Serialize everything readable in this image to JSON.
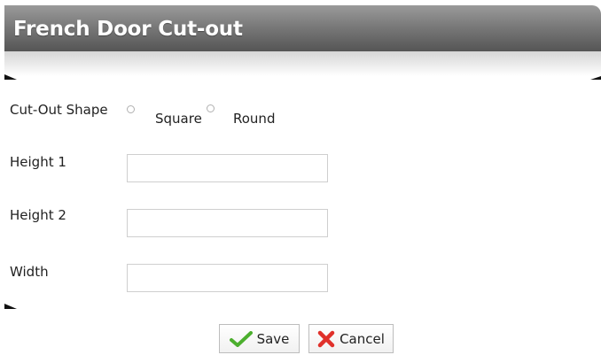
{
  "window": {
    "title": "French Door Cut-out"
  },
  "form": {
    "cutout_shape": {
      "label": "Cut-Out Shape",
      "options": [
        {
          "label": "Square",
          "selected": false
        },
        {
          "label": "Round",
          "selected": false
        }
      ]
    },
    "height1": {
      "label": "Height 1",
      "value": "",
      "placeholder": ""
    },
    "height2": {
      "label": "Height 2",
      "value": "",
      "placeholder": ""
    },
    "width": {
      "label": "Width",
      "value": "",
      "placeholder": ""
    }
  },
  "actions": {
    "save_label": "Save",
    "cancel_label": "Cancel"
  },
  "icons": {
    "save": "checkmark-icon",
    "cancel": "x-icon"
  },
  "colors": {
    "title_bar": "#7a7a7a",
    "save_icon": "#4caf2e",
    "cancel_icon": "#e0312b"
  }
}
